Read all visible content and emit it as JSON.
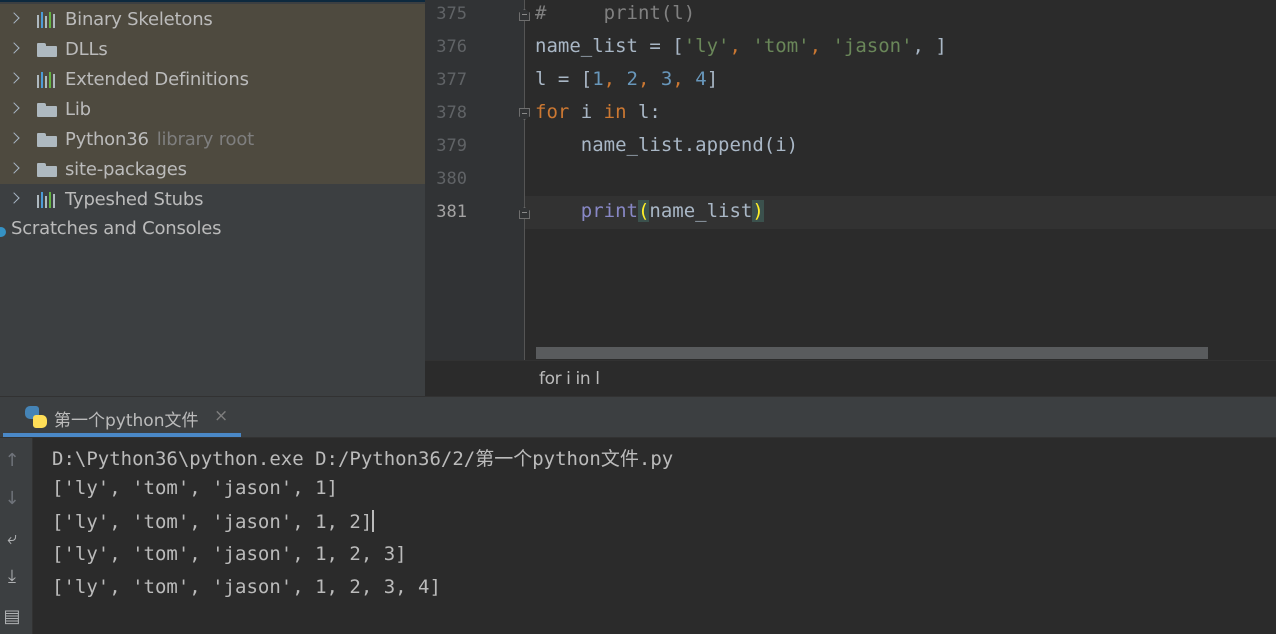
{
  "project_tree": {
    "items": [
      {
        "label": "Binary Skeletons",
        "icon": "library-bars-icon",
        "hint": ""
      },
      {
        "label": "DLLs",
        "icon": "folder-icon",
        "hint": ""
      },
      {
        "label": "Extended Definitions",
        "icon": "library-bars-icon",
        "hint": ""
      },
      {
        "label": "Lib",
        "icon": "folder-icon",
        "hint": ""
      },
      {
        "label": "Python36",
        "icon": "folder-icon",
        "hint": "library root"
      },
      {
        "label": "site-packages",
        "icon": "folder-icon",
        "hint": ""
      },
      {
        "label": "Typeshed Stubs",
        "icon": "library-bars-icon",
        "hint": ""
      }
    ],
    "scratches": "Scratches and Consoles"
  },
  "editor": {
    "line_numbers": [
      "375",
      "376",
      "377",
      "378",
      "379",
      "380",
      "381"
    ],
    "current_line": "381",
    "code": {
      "l375": {
        "comment": "#     print(l)"
      },
      "l376": {
        "var": "name_list = [",
        "s1": "'ly'",
        "sep": ", ",
        "s2": "'tom'",
        "s3": "'jason'",
        "end": ", ]"
      },
      "l377": {
        "var": "l = [",
        "n1": "1",
        "n2": "2",
        "n3": "3",
        "n4": "4",
        "sep": ", ",
        "end": "]"
      },
      "l378": {
        "kw_for": "for",
        "mid": " i ",
        "kw_in": "in",
        "end": " l:"
      },
      "l379": {
        "text": "    name_list.append(i)"
      },
      "l381": {
        "indent": "    ",
        "fn": "print",
        "open": "(",
        "arg": "name_list",
        "close": ")"
      }
    },
    "breadcrumb": "for i in l"
  },
  "run_panel": {
    "tab_label": "第一个python文件",
    "tab_close": "×",
    "toolbar": {
      "up": "↑",
      "down": "↓",
      "wrap": "⤶",
      "scroll_end": "⤓",
      "print": "▤"
    },
    "console_lines": [
      "D:\\Python36\\python.exe D:/Python36/2/第一个python文件.py",
      "['ly', 'tom', 'jason', 1]",
      "['ly', 'tom', 'jason', 1, 2]",
      "['ly', 'tom', 'jason', 1, 2, 3]",
      "['ly', 'tom', 'jason', 1, 2, 3, 4]"
    ]
  },
  "colors": {
    "background": "#2b2b2b",
    "panel": "#3c3f41",
    "library_row_highlight": "#4e4a3f",
    "keyword": "#cc7832",
    "string": "#6a8759",
    "number": "#6897bb",
    "builtin": "#8888c6",
    "accent": "#4a88c7"
  }
}
